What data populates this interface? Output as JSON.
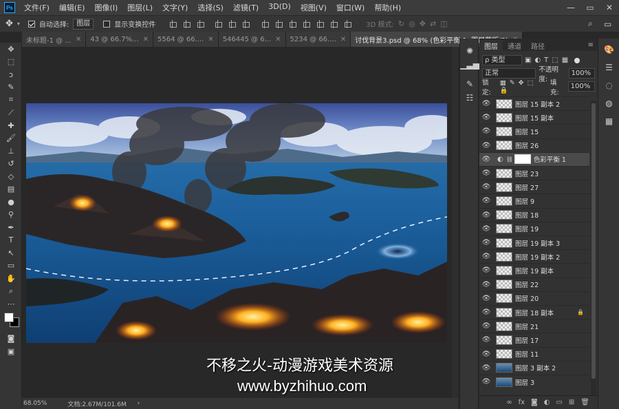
{
  "app": {
    "logo": "Ps"
  },
  "menu": [
    "文件(F)",
    "编辑(E)",
    "图像(I)",
    "图层(L)",
    "文字(Y)",
    "选择(S)",
    "滤镜(T)",
    "3D(D)",
    "视图(V)",
    "窗口(W)",
    "帮助(H)"
  ],
  "options_bar": {
    "auto_select_label": "自动选择:",
    "auto_select_value": "图层",
    "show_transform_label": "显示变换控件",
    "mode_3d": "3D 模式:"
  },
  "tabs": [
    {
      "label": "未标题-1 @ ...",
      "active": false
    },
    {
      "label": "43 @ 66.7%...",
      "active": false
    },
    {
      "label": "5564 @ 66....",
      "active": false
    },
    {
      "label": "546445 @ 6...",
      "active": false
    },
    {
      "label": "5234 @ 66....",
      "active": false
    },
    {
      "label": "讨伐背景3.psd @ 68% (色彩平衡 1, 图层蒙版/8)",
      "active": true
    }
  ],
  "status": {
    "zoom": "68.05%",
    "doc_info": "文档:2.67M/101.6M"
  },
  "watermark": {
    "line1": "不移之火-动漫游戏美术资源",
    "line2": "www.byzhihuo.com"
  },
  "layers_panel": {
    "tabs": [
      {
        "label": "图层",
        "active": true
      },
      {
        "label": "通道",
        "active": false
      },
      {
        "label": "路径",
        "active": false
      }
    ],
    "filter_kind": "ρ 类型",
    "blend_mode": "正常",
    "opacity_label": "不透明度:",
    "opacity_value": "100%",
    "lock_label": "锁定:",
    "fill_label": "填充:",
    "fill_value": "100%",
    "layers": [
      {
        "name": "图层 15 副本 2",
        "kind": "pixel",
        "selected": false,
        "locked": false
      },
      {
        "name": "图层 15 副本",
        "kind": "pixel",
        "selected": false,
        "locked": false
      },
      {
        "name": "图层 15",
        "kind": "pixel",
        "selected": false,
        "locked": false
      },
      {
        "name": "图层 26",
        "kind": "pixel",
        "selected": false,
        "locked": false
      },
      {
        "name": "色彩平衡 1",
        "kind": "adjustment",
        "selected": true,
        "locked": false
      },
      {
        "name": "图层 23",
        "kind": "pixel",
        "selected": false,
        "locked": false
      },
      {
        "name": "图层 27",
        "kind": "pixel",
        "selected": false,
        "locked": false
      },
      {
        "name": "图层 9",
        "kind": "pixel",
        "selected": false,
        "locked": false
      },
      {
        "name": "图层 18",
        "kind": "pixel",
        "selected": false,
        "locked": false
      },
      {
        "name": "图层 19",
        "kind": "pixel",
        "selected": false,
        "locked": false
      },
      {
        "name": "图层 19 副本 3",
        "kind": "pixel",
        "selected": false,
        "locked": false
      },
      {
        "name": "图层 19 副本 2",
        "kind": "pixel",
        "selected": false,
        "locked": false
      },
      {
        "name": "图层 19 副本",
        "kind": "pixel",
        "selected": false,
        "locked": false
      },
      {
        "name": "图层 22",
        "kind": "pixel",
        "selected": false,
        "locked": false
      },
      {
        "name": "图层 20",
        "kind": "pixel",
        "selected": false,
        "locked": false
      },
      {
        "name": "图层 18 副本",
        "kind": "pixel",
        "selected": false,
        "locked": true
      },
      {
        "name": "图层 21",
        "kind": "pixel",
        "selected": false,
        "locked": false
      },
      {
        "name": "图层 17",
        "kind": "pixel",
        "selected": false,
        "locked": false
      },
      {
        "name": "图层 11",
        "kind": "pixel",
        "selected": false,
        "locked": false
      },
      {
        "name": "图层 3 副本 2",
        "kind": "sea",
        "selected": false,
        "locked": false
      },
      {
        "name": "图层 3",
        "kind": "sea",
        "selected": false,
        "locked": false
      }
    ]
  }
}
